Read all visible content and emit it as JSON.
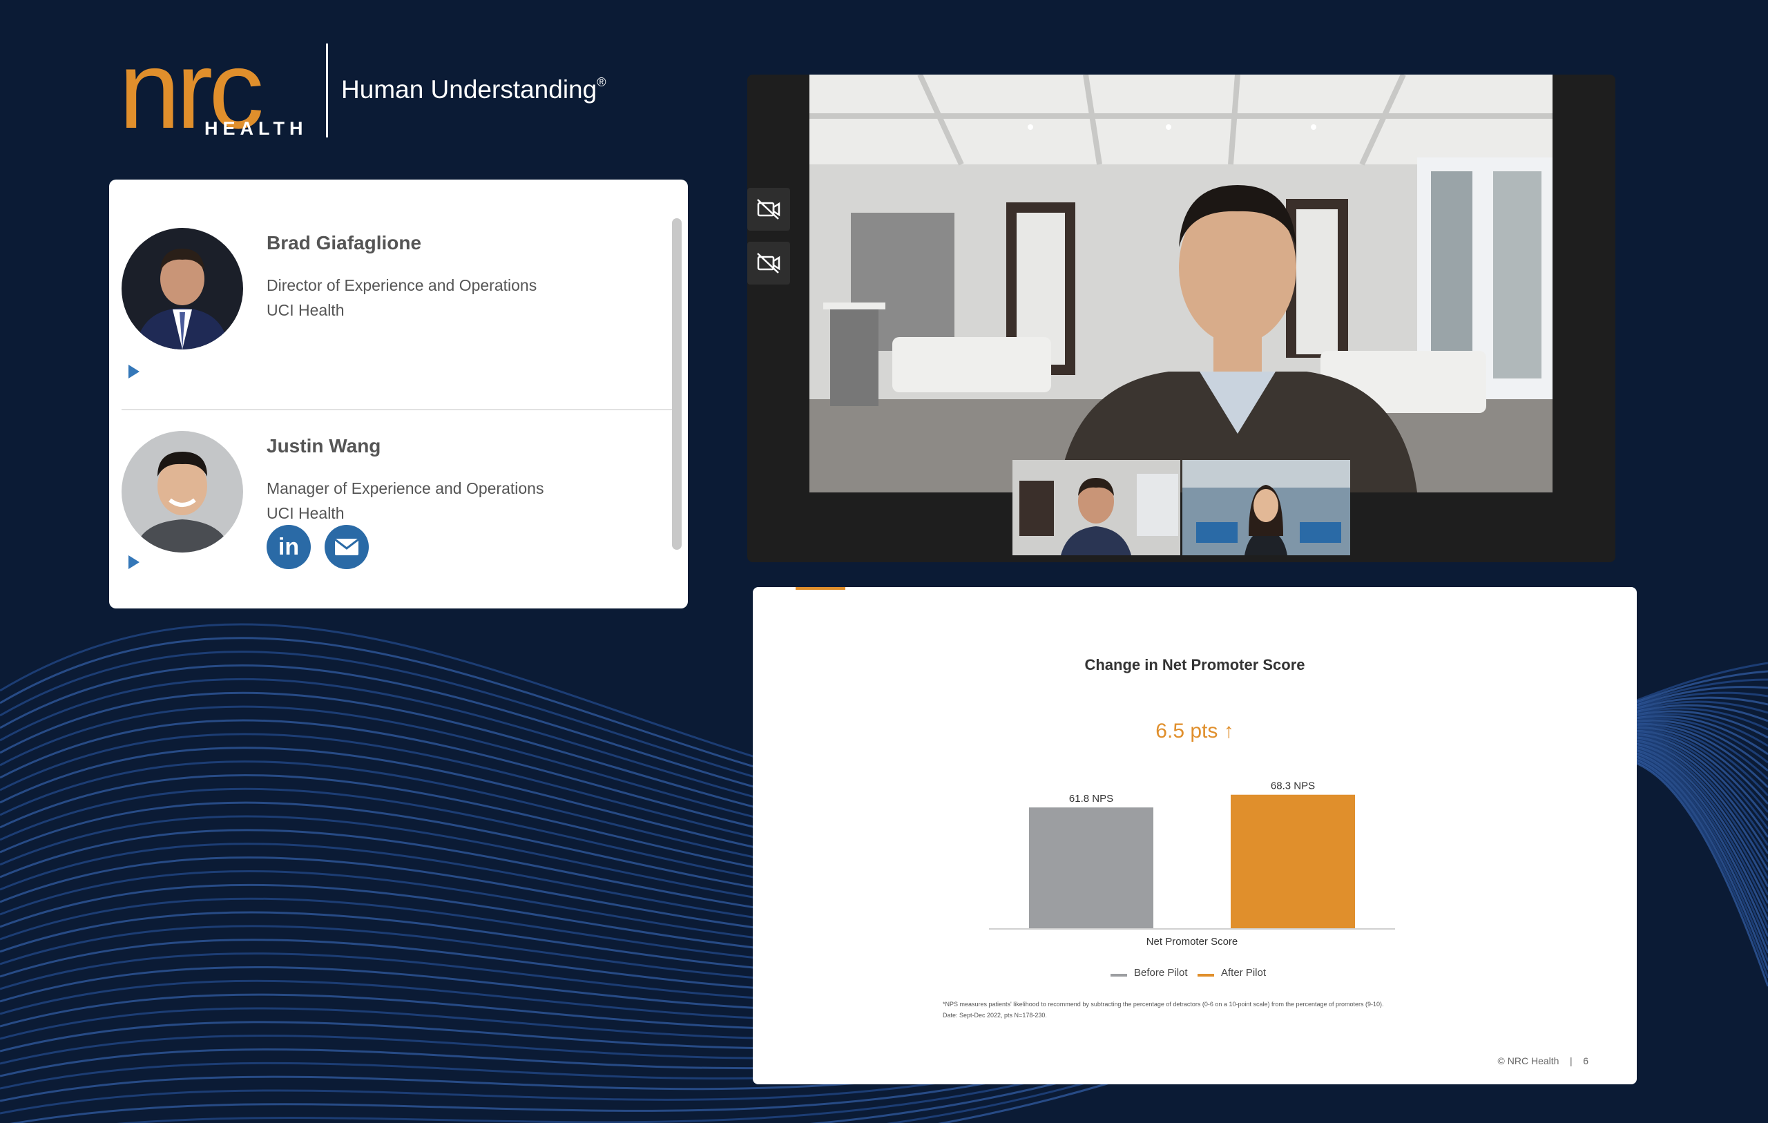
{
  "logo": {
    "brand": "nrc",
    "sub": "HEALTH",
    "tagline": "Human Understanding",
    "reg_mark": "®"
  },
  "speakers": [
    {
      "name": "Brad Giafaglione",
      "role": "Director of Experience and Operations",
      "org": "UCI Health"
    },
    {
      "name": "Justin Wang",
      "role": "Manager of Experience and Operations",
      "org": "UCI Health",
      "social": {
        "linkedin_label": "in",
        "email_icon": "envelope-icon"
      }
    }
  ],
  "video": {
    "controls": [
      "camera-off-icon",
      "camera-off-icon"
    ]
  },
  "slide": {
    "footnote_line1": "*NPS measures patients' likelihood to recommend by subtracting the percentage of detractors (0-6 on a 10-point scale) from the percentage of promoters (9-10).",
    "footnote_line2": "Date: Sept-Dec 2022, pts N=178-230.",
    "footer_left": "© NRC Health",
    "footer_sep": "|",
    "page_number": "6"
  },
  "chart_data": {
    "type": "bar",
    "title": "Change in Net Promoter Score",
    "annotation": "6.5 pts ↑",
    "categories": [
      "Net Promoter Score"
    ],
    "xlabel": "Net Promoter Score",
    "series": [
      {
        "name": "Before Pilot",
        "values": [
          61.8
        ],
        "label": "61.8 NPS",
        "color": "#9c9ea1"
      },
      {
        "name": "After Pilot",
        "values": [
          68.3
        ],
        "label": "68.3 NPS",
        "color": "#e08f2c"
      }
    ],
    "legend_position": "bottom",
    "grid": false
  },
  "colors": {
    "background": "#0b1b35",
    "accent": "#e08f2c",
    "link_blue": "#2a6aa6"
  }
}
